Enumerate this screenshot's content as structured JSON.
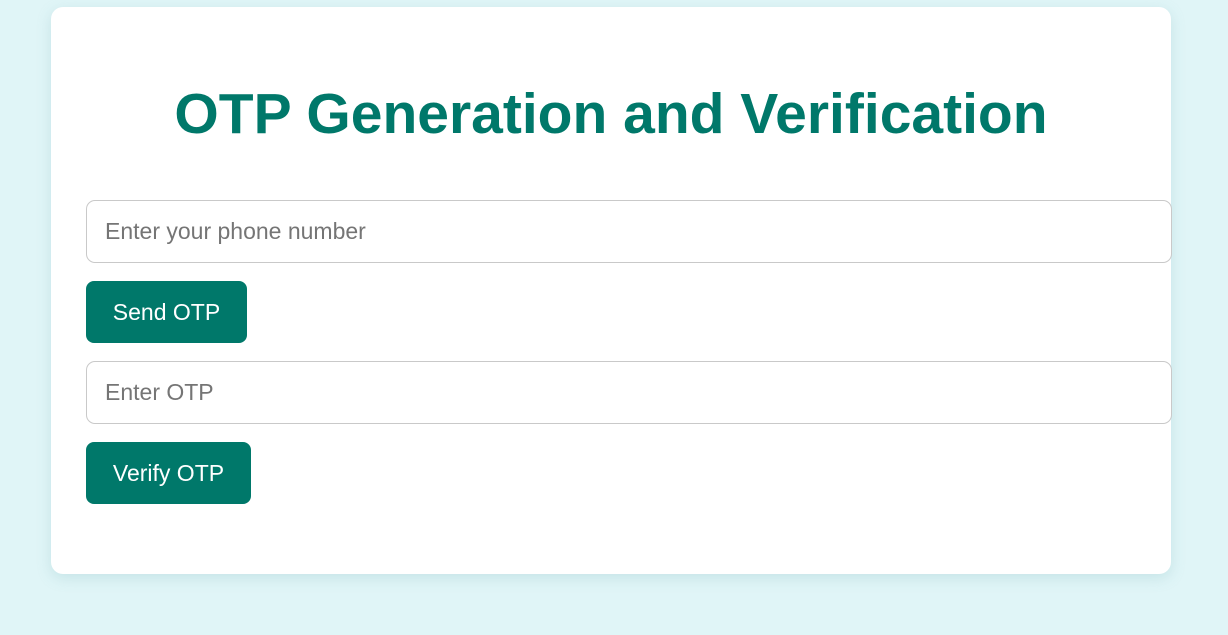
{
  "card": {
    "title": "OTP Generation and Verification"
  },
  "phone": {
    "placeholder": "Enter your phone number",
    "value": ""
  },
  "send_button": {
    "label": "Send OTP"
  },
  "otp": {
    "placeholder": "Enter OTP",
    "value": ""
  },
  "verify_button": {
    "label": "Verify OTP"
  },
  "colors": {
    "accent": "#00786a",
    "background": "#e0f5f7",
    "card": "#ffffff"
  }
}
